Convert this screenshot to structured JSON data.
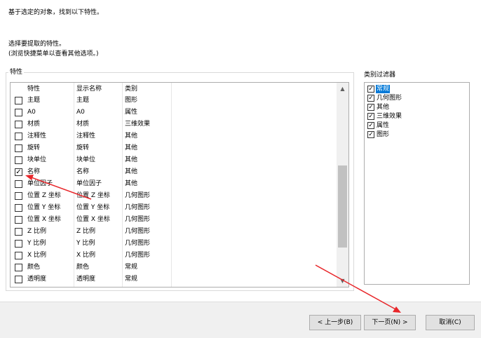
{
  "instructions": {
    "line1": "基于选定的对象，找到以下特性。",
    "line2": "选择要提取的特性。",
    "line3": "(浏览快捷菜单以查看其他选项。)"
  },
  "properties_group": {
    "label": "特性",
    "columns": [
      "特性",
      "显示名称",
      "类别"
    ],
    "rows": [
      {
        "name": "主题",
        "display": "主题",
        "category": "图形",
        "checked": false
      },
      {
        "name": "A0",
        "display": "A0",
        "category": "属性",
        "checked": false
      },
      {
        "name": "材质",
        "display": "材质",
        "category": "三维效果",
        "checked": false
      },
      {
        "name": "注释性",
        "display": "注释性",
        "category": "其他",
        "checked": false
      },
      {
        "name": "旋转",
        "display": "旋转",
        "category": "其他",
        "checked": false
      },
      {
        "name": "块单位",
        "display": "块单位",
        "category": "其他",
        "checked": false
      },
      {
        "name": "名称",
        "display": "名称",
        "category": "其他",
        "checked": true
      },
      {
        "name": "单位因子",
        "display": "单位因子",
        "category": "其他",
        "checked": false
      },
      {
        "name": "位置 Z 坐标",
        "display": "位置 Z 坐标",
        "category": "几何图形",
        "checked": false
      },
      {
        "name": "位置 Y 坐标",
        "display": "位置 Y 坐标",
        "category": "几何图形",
        "checked": false
      },
      {
        "name": "位置 X 坐标",
        "display": "位置 X 坐标",
        "category": "几何图形",
        "checked": false
      },
      {
        "name": "Z 比例",
        "display": "Z 比例",
        "category": "几何图形",
        "checked": false
      },
      {
        "name": "Y 比例",
        "display": "Y 比例",
        "category": "几何图形",
        "checked": false
      },
      {
        "name": "X 比例",
        "display": "X 比例",
        "category": "几何图形",
        "checked": false
      },
      {
        "name": "颜色",
        "display": "颜色",
        "category": "常规",
        "checked": false
      },
      {
        "name": "透明度",
        "display": "透明度",
        "category": "常规",
        "checked": false
      }
    ],
    "scroll_up_icon": "chevron-up-icon",
    "scroll_down_icon": "chevron-down-icon"
  },
  "filter_group": {
    "label": "类别过滤器",
    "items": [
      {
        "label": "常规",
        "checked": true,
        "selected": true
      },
      {
        "label": "几何图形",
        "checked": true,
        "selected": false
      },
      {
        "label": "其他",
        "checked": true,
        "selected": false
      },
      {
        "label": "三维效果",
        "checked": true,
        "selected": false
      },
      {
        "label": "属性",
        "checked": true,
        "selected": false
      },
      {
        "label": "图形",
        "checked": true,
        "selected": false
      }
    ]
  },
  "buttons": {
    "back": "< 上一步(B)",
    "next": "下一页(N) >",
    "cancel": "取消(C)"
  },
  "colors": {
    "selection": "#0078d7",
    "annotation_arrow": "#e8262a"
  }
}
